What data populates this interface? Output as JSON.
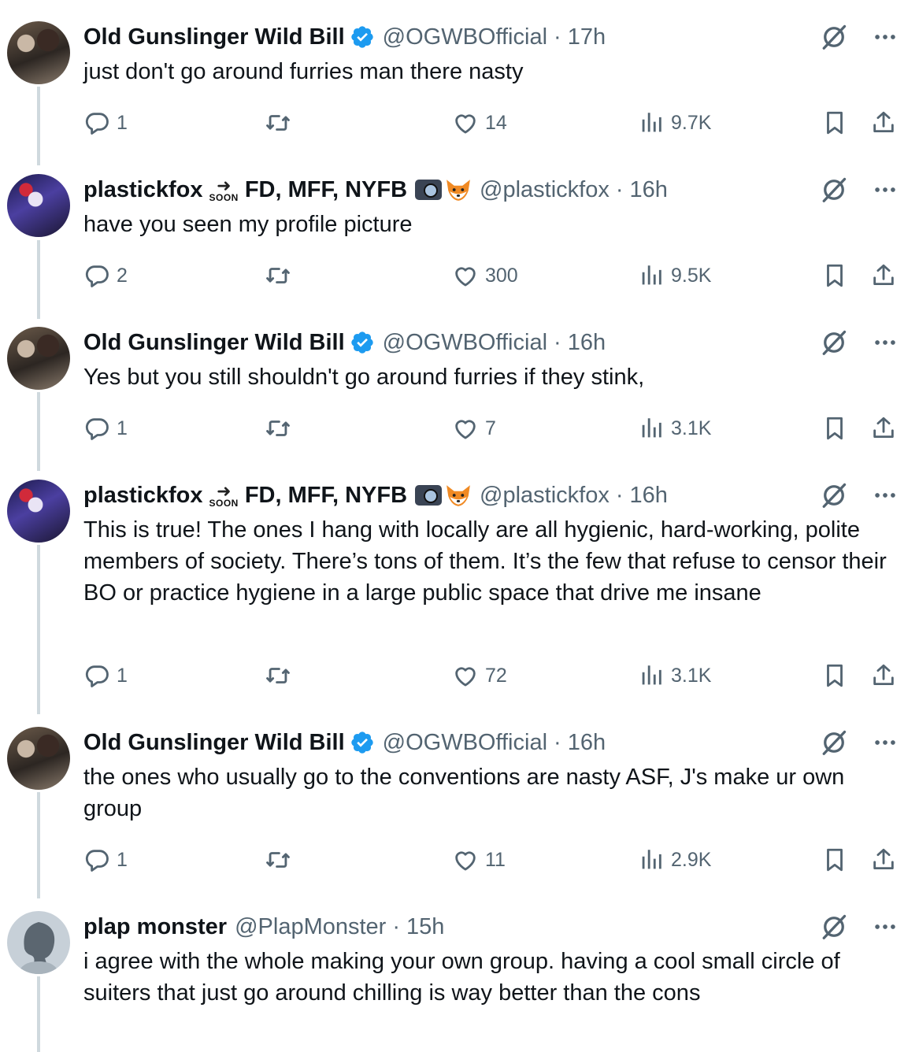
{
  "tweets": [
    {
      "name": "Old Gunslinger Wild Bill",
      "verified": true,
      "handle": "@OGWBOfficial",
      "time": "17h",
      "text": "just don't go around furries man there nasty",
      "replies": "1",
      "likes": "14",
      "views": "9.7K"
    },
    {
      "name": "plastickfox",
      "soon": "SOON",
      "name_suffix": "FD, MFF, NYFB",
      "handle": "@plastickfox",
      "time": "16h",
      "text": "have you seen my profile picture",
      "replies": "2",
      "likes": "300",
      "views": "9.5K"
    },
    {
      "name": "Old Gunslinger Wild Bill",
      "verified": true,
      "handle": "@OGWBOfficial",
      "time": "16h",
      "text": "Yes but you still shouldn't go around furries if they stink,",
      "replies": "1",
      "likes": "7",
      "views": "3.1K"
    },
    {
      "name": "plastickfox",
      "soon": "SOON",
      "name_suffix": "FD, MFF, NYFB",
      "handle": "@plastickfox",
      "time": "16h",
      "text": "This is true! The ones I hang with locally are all hygienic, hard-working, polite members of society. There’s tons of them. It’s the few that refuse to censor their BO or practice hygiene in a large public space that drive me insane",
      "replies": "1",
      "likes": "72",
      "views": "3.1K"
    },
    {
      "name": "Old Gunslinger Wild Bill",
      "verified": true,
      "handle": "@OGWBOfficial",
      "time": "16h",
      "text": "the ones who usually go to the conventions are nasty ASF, J's make ur own group",
      "replies": "1",
      "likes": "11",
      "views": "2.9K"
    },
    {
      "name": "plap monster",
      "handle": "@PlapMonster",
      "time": "15h",
      "text": "i agree with the whole making your own group. having a cool small circle of suiters that just go around chilling is way better than the cons"
    }
  ],
  "separator": "·",
  "colors": {
    "verified_blue": "#1d9bf0",
    "secondary_text": "#536471",
    "thread_line": "#cfd9de"
  },
  "icons": [
    "reply-icon",
    "retweet-icon",
    "like-icon",
    "views-icon",
    "bookmark-icon",
    "share-icon",
    "grok-icon",
    "more-icon",
    "verified-badge-icon"
  ]
}
